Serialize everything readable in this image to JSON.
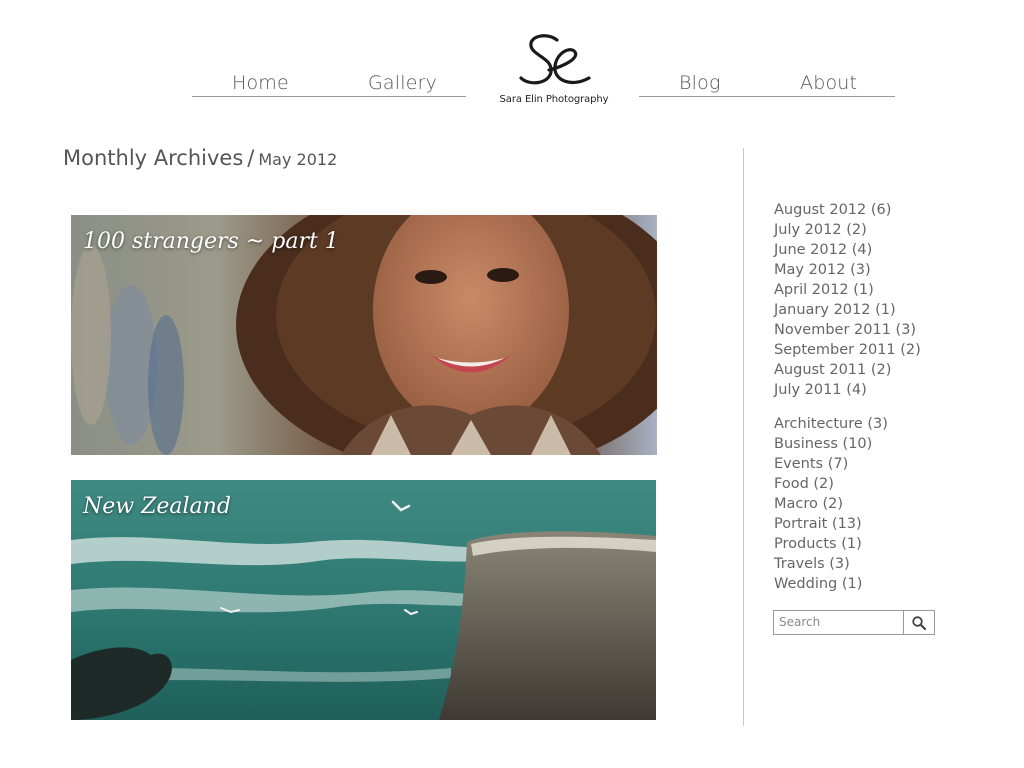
{
  "nav": {
    "items": [
      {
        "label": "Home"
      },
      {
        "label": "Gallery"
      },
      {
        "label": "Blog"
      },
      {
        "label": "About"
      }
    ]
  },
  "logo": {
    "monogram": "Se",
    "text": "Sara Elin Photography"
  },
  "archive": {
    "title": "Monthly Archives",
    "separator": "/",
    "month": "May 2012"
  },
  "posts": [
    {
      "title": "100 strangers ~ part 1"
    },
    {
      "title": "New Zealand"
    }
  ],
  "sidebar": {
    "archives": [
      "August 2012 (6)",
      "July 2012 (2)",
      "June 2012 (4)",
      "May 2012 (3)",
      "April 2012 (1)",
      "January 2012 (1)",
      "November 2011 (3)",
      "September 2011 (2)",
      "August 2011 (2)",
      "July 2011 (4)"
    ],
    "categories": [
      "Architecture (3)",
      "Business (10)",
      "Events (7)",
      "Food (2)",
      "Macro (2)",
      "Portrait (13)",
      "Products (1)",
      "Travels (3)",
      "Wedding (1)"
    ],
    "search": {
      "placeholder": "Search",
      "icon": "search-icon"
    }
  }
}
